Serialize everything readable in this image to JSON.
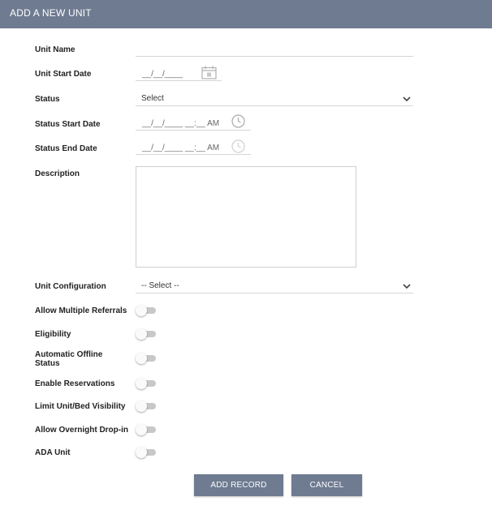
{
  "header": {
    "title": "ADD A NEW UNIT"
  },
  "form": {
    "unit_name": {
      "label": "Unit Name",
      "value": ""
    },
    "unit_start_date": {
      "label": "Unit Start Date",
      "mask": "__/__/____"
    },
    "status": {
      "label": "Status",
      "value": "Select"
    },
    "status_start_date": {
      "label": "Status Start Date",
      "mask": "__/__/____ __:__ AM"
    },
    "status_end_date": {
      "label": "Status End Date",
      "mask": "__/__/____ __:__ AM"
    },
    "description": {
      "label": "Description",
      "value": ""
    },
    "unit_configuration": {
      "label": "Unit Configuration",
      "value": "-- Select --"
    },
    "toggles": {
      "allow_multiple_referrals": {
        "label": "Allow Multiple Referrals",
        "on": false
      },
      "eligibility": {
        "label": "Eligibility",
        "on": false
      },
      "automatic_offline_status": {
        "label_line1": "Automatic Offline",
        "label_line2": "Status",
        "on": false
      },
      "enable_reservations": {
        "label": "Enable Reservations",
        "on": false
      },
      "limit_unit_bed_visibility": {
        "label": "Limit Unit/Bed Visibility",
        "on": false
      },
      "allow_overnight_dropin": {
        "label": "Allow Overnight Drop-in",
        "on": false
      },
      "ada_unit": {
        "label": "ADA Unit",
        "on": false
      }
    }
  },
  "buttons": {
    "add_record": "ADD RECORD",
    "cancel": "CANCEL"
  },
  "colors": {
    "header_bg": "#6e7b91",
    "button_bg": "#6e7b91",
    "toggle_track": "#c8c8c8",
    "icon": "#b0b0b0"
  },
  "icons": {
    "calendar": "calendar-icon",
    "clock": "clock-icon",
    "dropdown": "chevron-down-icon"
  }
}
